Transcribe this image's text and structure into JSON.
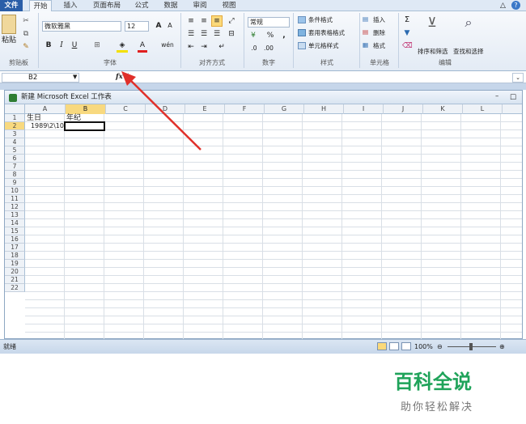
{
  "tabs": [
    "文件",
    "开始",
    "插入",
    "页面布局",
    "公式",
    "数据",
    "审阅",
    "视图"
  ],
  "ribbon": {
    "clipboard": {
      "paste": "粘贴",
      "group": "剪贴板"
    },
    "font": {
      "name": "微软雅黑",
      "size": "12",
      "bold": "B",
      "italic": "I",
      "underline": "U",
      "group": "字体"
    },
    "align": {
      "group": "对齐方式"
    },
    "number": {
      "format": "常规",
      "percent": "%",
      "comma": ",",
      "group": "数字"
    },
    "styles": {
      "cond": "条件格式",
      "table": "套用表格格式",
      "cell": "单元格样式",
      "group": "样式"
    },
    "cells": {
      "insert": "插入",
      "delete": "删除",
      "format": "格式",
      "group": "单元格"
    },
    "edit": {
      "sigma": "Σ",
      "sort": "排序和筛选",
      "find": "查找和选择",
      "group": "编辑"
    }
  },
  "formula_bar": {
    "name_box": "B2",
    "fx": "fx",
    "value": ""
  },
  "workbook": {
    "title": "新建 Microsoft Excel 工作表"
  },
  "columns": [
    "A",
    "B",
    "C",
    "D",
    "E",
    "F",
    "G",
    "H",
    "I",
    "J",
    "K",
    "L"
  ],
  "selected_column": "B",
  "rows": [
    "1",
    "2",
    "3",
    "4",
    "5",
    "6",
    "7",
    "8",
    "9",
    "10",
    "11",
    "12",
    "13",
    "14",
    "15",
    "16",
    "17",
    "18",
    "19",
    "20",
    "21",
    "22"
  ],
  "selected_row": "2",
  "cells": {
    "A1": "生日",
    "B1": "年纪",
    "A2": "1989\\2\\10"
  },
  "status": {
    "ready": "就绪",
    "zoom": "100%"
  },
  "watermark": {
    "main": "百科全说",
    "sub": "助你轻松解决"
  },
  "colors": {
    "file_tab": "#2a5ea8",
    "selection": "#f8d97f",
    "arrow": "#e0302a",
    "watermark_main": "#1fa35a"
  }
}
